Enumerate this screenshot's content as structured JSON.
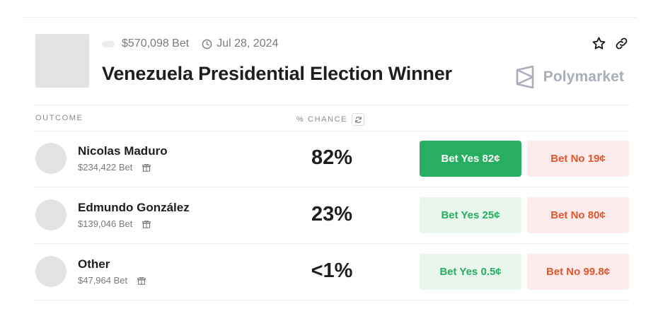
{
  "market": {
    "bet_total": "$570,098 Bet",
    "date": "Jul 28, 2024",
    "title": "Venezuela Presidential Election Winner",
    "brand": "Polymarket"
  },
  "table": {
    "col_outcome": "OUTCOME",
    "col_chance": "% CHANCE"
  },
  "outcomes": [
    {
      "name": "Nicolas Maduro",
      "bet": "$234,422 Bet",
      "chance": "82%",
      "yes_label": "Bet Yes 82¢",
      "no_label": "Bet No 19¢",
      "yes_active": true
    },
    {
      "name": "Edmundo González",
      "bet": "$139,046 Bet",
      "chance": "23%",
      "yes_label": "Bet Yes 25¢",
      "no_label": "Bet No 80¢",
      "yes_active": false
    },
    {
      "name": "Other",
      "bet": "$47,964 Bet",
      "chance": "<1%",
      "yes_label": "Bet Yes 0.5¢",
      "no_label": "Bet No 99.8¢",
      "yes_active": false
    }
  ],
  "colors": {
    "yes_green": "#27ae60",
    "yes_light": "#e9f6ec",
    "no_red": "#e2562d",
    "no_light": "#fdeceb"
  },
  "icons": [
    "clock-icon",
    "star-icon",
    "link-icon",
    "polymarket-logo-icon",
    "refresh-icon",
    "gift-icon"
  ]
}
